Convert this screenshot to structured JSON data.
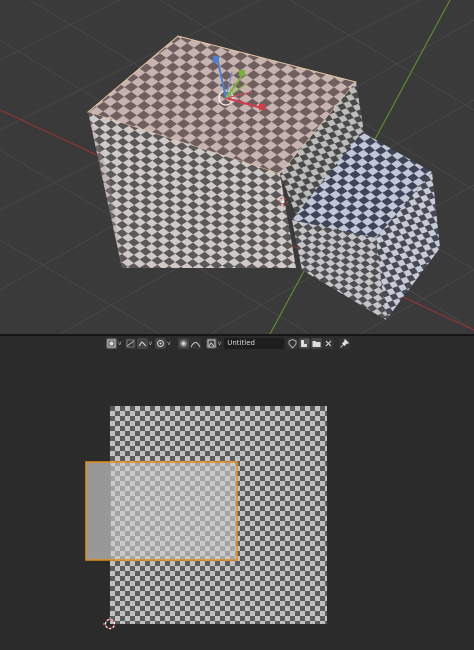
{
  "uv_editor": {
    "header": {
      "mode_icon": "uv-vertex-select-icon",
      "sync_icon": "sync-selection-icon",
      "sticky_icon": "sticky-selection-icon",
      "pivot_icon": "pivot-point-icon",
      "proportional_icon": "proportional-edit-icon",
      "image_icon": "image-browse-icon",
      "image_name": "Untitled",
      "fake_user_icon": "fake-user-shield-icon",
      "new_image_icon": "new-image-icon",
      "open_image_icon": "open-folder-icon",
      "unlink_icon": "close-icon",
      "pin_icon": "pin-icon"
    }
  },
  "colors": {
    "viewport_bg": "#3a3a3a",
    "uv_bg": "#2b2b2b",
    "selection_orange": "#e58c1b",
    "axis_red": "#a23a3a",
    "axis_green": "#6c9a2e",
    "gizmo_blue": "#4f7fd1",
    "gizmo_green": "#79b23a",
    "gizmo_red": "#d43c4a"
  }
}
